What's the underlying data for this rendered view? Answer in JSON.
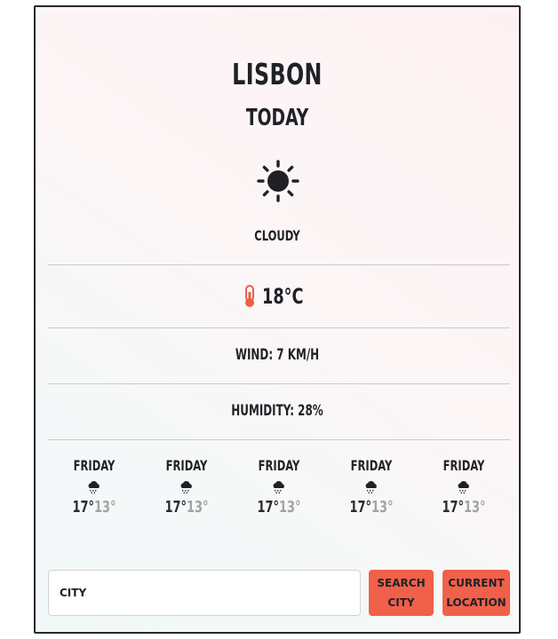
{
  "weather": {
    "city": "LISBON",
    "day": "TODAY",
    "main_icon": "sun-icon",
    "condition": "CLOUDY",
    "temperature": "18°C",
    "temperature_icon": "thermometer-icon",
    "wind": "WIND: 7 KM/H",
    "humidity": "HUMIDITY: 28%"
  },
  "forecast": [
    {
      "day": "FRIDAY",
      "icon": "rain-cloud-icon",
      "max": "17°",
      "min": "13°"
    },
    {
      "day": "FRIDAY",
      "icon": "rain-cloud-icon",
      "max": "17°",
      "min": "13°"
    },
    {
      "day": "FRIDAY",
      "icon": "rain-cloud-icon",
      "max": "17°",
      "min": "13°"
    },
    {
      "day": "FRIDAY",
      "icon": "rain-cloud-icon",
      "max": "17°",
      "min": "13°"
    },
    {
      "day": "FRIDAY",
      "icon": "rain-cloud-icon",
      "max": "17°",
      "min": "13°"
    }
  ],
  "search": {
    "placeholder": "CITY",
    "value": "",
    "search_button_line1": "SEARCH",
    "search_button_line2": "CITY",
    "location_button_line1": "CURRENT",
    "location_button_line2": "LOCATION"
  },
  "colors": {
    "accent": "#f0604a",
    "text": "#1f2126",
    "min_temp": "#a3a3a3",
    "thermometer": "#e8604a"
  }
}
